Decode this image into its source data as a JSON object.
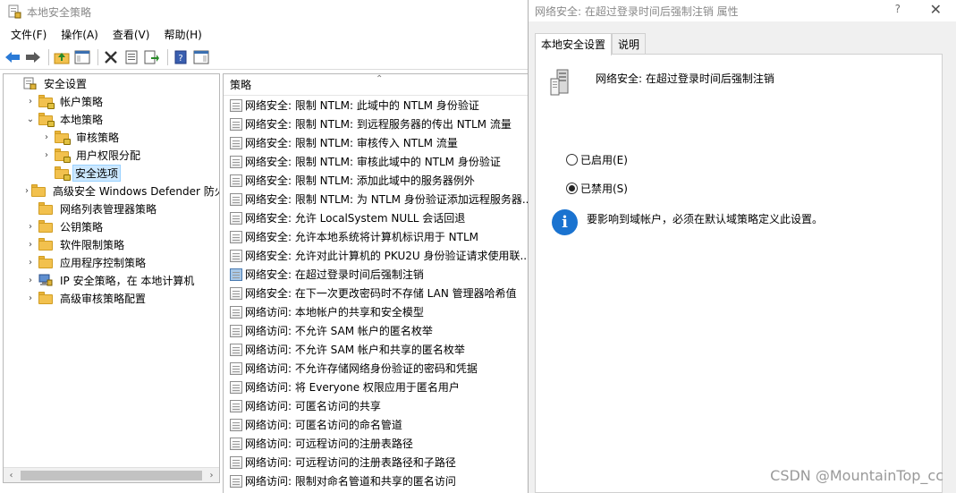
{
  "main": {
    "title": "本地安全策略",
    "menu": [
      "文件(F)",
      "操作(A)",
      "查看(V)",
      "帮助(H)"
    ],
    "tree": [
      {
        "label": "安全设置",
        "level": 0,
        "expander": "",
        "icon": "security-settings-icon"
      },
      {
        "label": "帐户策略",
        "level": 1,
        "expander": "›",
        "icon": "folder-lock-icon"
      },
      {
        "label": "本地策略",
        "level": 1,
        "expander": "⌄",
        "icon": "folder-lock-icon"
      },
      {
        "label": "审核策略",
        "level": 2,
        "expander": "›",
        "icon": "folder-lock-icon"
      },
      {
        "label": "用户权限分配",
        "level": 2,
        "expander": "›",
        "icon": "folder-lock-icon"
      },
      {
        "label": "安全选项",
        "level": 2,
        "expander": "",
        "icon": "folder-lock-icon",
        "selected": true
      },
      {
        "label": "高级安全 Windows Defender 防火墙",
        "level": 1,
        "expander": "›",
        "icon": "folder-icon"
      },
      {
        "label": "网络列表管理器策略",
        "level": 1,
        "expander": "",
        "icon": "folder-icon"
      },
      {
        "label": "公钥策略",
        "level": 1,
        "expander": "›",
        "icon": "folder-icon"
      },
      {
        "label": "软件限制策略",
        "level": 1,
        "expander": "›",
        "icon": "folder-icon"
      },
      {
        "label": "应用程序控制策略",
        "level": 1,
        "expander": "›",
        "icon": "folder-icon"
      },
      {
        "label": "IP 安全策略，在 本地计算机",
        "level": 1,
        "expander": "›",
        "icon": "ip-security-icon"
      },
      {
        "label": "高级审核策略配置",
        "level": 1,
        "expander": "›",
        "icon": "folder-icon"
      }
    ],
    "list_header": "策略",
    "list": [
      "网络安全: 限制 NTLM: 此域中的 NTLM 身份验证",
      "网络安全: 限制 NTLM: 到远程服务器的传出 NTLM 流量",
      "网络安全: 限制 NTLM: 审核传入 NTLM 流量",
      "网络安全: 限制 NTLM: 审核此域中的 NTLM 身份验证",
      "网络安全: 限制 NTLM: 添加此域中的服务器例外",
      "网络安全: 限制 NTLM: 为 NTLM 身份验证添加远程服务器...",
      "网络安全: 允许 LocalSystem NULL 会话回退",
      "网络安全: 允许本地系统将计算机标识用于 NTLM",
      "网络安全: 允许对此计算机的 PKU2U 身份验证请求使用联...",
      "网络安全: 在超过登录时间后强制注销",
      "网络安全: 在下一次更改密码时不存储 LAN 管理器哈希值",
      "网络访问: 本地帐户的共享和安全模型",
      "网络访问: 不允许 SAM 帐户的匿名枚举",
      "网络访问: 不允许 SAM 帐户和共享的匿名枚举",
      "网络访问: 不允许存储网络身份验证的密码和凭据",
      "网络访问: 将 Everyone 权限应用于匿名用户",
      "网络访问: 可匿名访问的共享",
      "网络访问: 可匿名访问的命名管道",
      "网络访问: 可远程访问的注册表路径",
      "网络访问: 可远程访问的注册表路径和子路径",
      "网络访问: 限制对命名管道和共享的匿名访问"
    ],
    "selected_list_index": 9
  },
  "dialog": {
    "title": "网络安全: 在超过登录时间后强制注销 属性",
    "help": "?",
    "close": "✕",
    "tabs": [
      "本地安全设置",
      "说明"
    ],
    "policy_name": "网络安全: 在超过登录时间后强制注销",
    "options": [
      {
        "label": "已启用(E)",
        "checked": false
      },
      {
        "label": "已禁用(S)",
        "checked": true
      }
    ],
    "info_text": "要影响到域帐户，必须在默认域策略定义此设置。"
  },
  "watermark": "CSDN @MountainTop_cc",
  "colors": {
    "selection": "#cce8ff",
    "info_blue": "#1a73d0"
  }
}
